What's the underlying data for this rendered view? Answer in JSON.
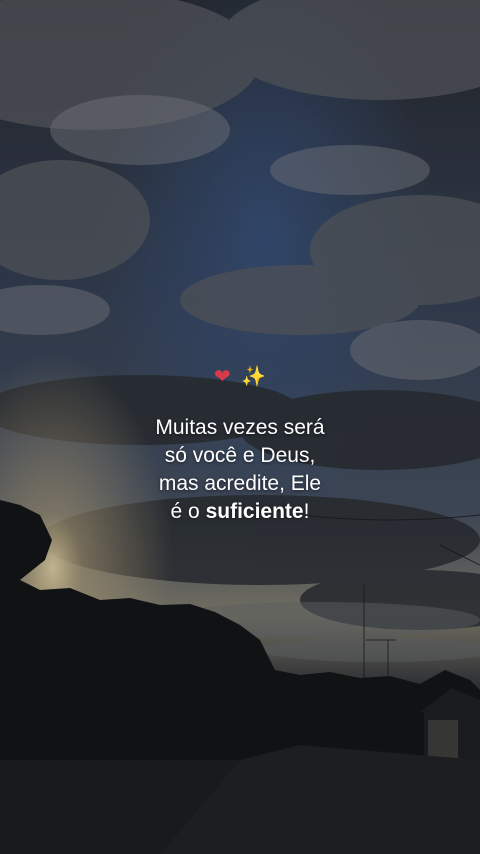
{
  "background": {
    "description_icon": "sunset-sky-photo",
    "colors": {
      "sky_top": "#2b2f36",
      "sky_mid": "#3e4b66",
      "cloud": "#6b6f76",
      "horizon_glow": "#c9b489",
      "ground": "#151719"
    }
  },
  "emojis": {
    "heart": "❤",
    "sparkles": "✨",
    "heart_icon": "heart-ribbon-icon",
    "sparkles_icon": "sparkles-icon"
  },
  "quote": {
    "line1": "Muitas vezes será",
    "line2": "só você e Deus,",
    "line3": "mas acredite, Ele",
    "line4_prefix": "é o ",
    "line4_bold": "suficiente",
    "line4_suffix": "!"
  }
}
